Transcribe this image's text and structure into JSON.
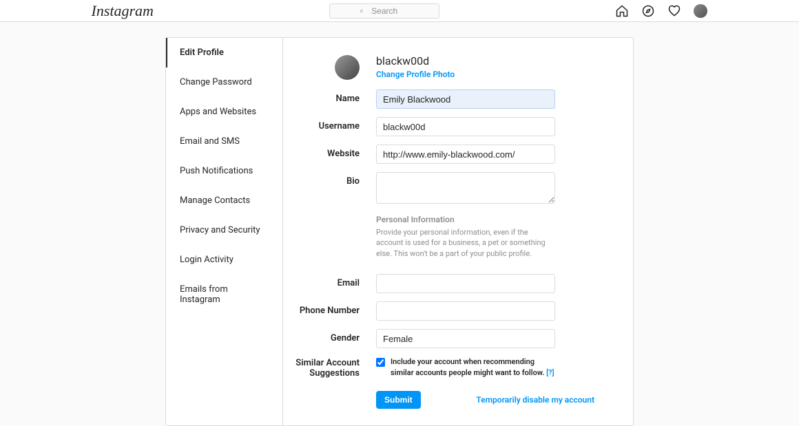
{
  "brand": "Instagram",
  "search": {
    "placeholder": "Search"
  },
  "sidebar": {
    "items": [
      {
        "label": "Edit Profile",
        "active": true
      },
      {
        "label": "Change Password",
        "active": false
      },
      {
        "label": "Apps and Websites",
        "active": false
      },
      {
        "label": "Email and SMS",
        "active": false
      },
      {
        "label": "Push Notifications",
        "active": false
      },
      {
        "label": "Manage Contacts",
        "active": false
      },
      {
        "label": "Privacy and Security",
        "active": false
      },
      {
        "label": "Login Activity",
        "active": false
      },
      {
        "label": "Emails from Instagram",
        "active": false
      }
    ]
  },
  "profile": {
    "username": "blackw00d",
    "change_photo_label": "Change Profile Photo"
  },
  "labels": {
    "name": "Name",
    "username": "Username",
    "website": "Website",
    "bio": "Bio",
    "email": "Email",
    "phone": "Phone Number",
    "gender": "Gender",
    "similar": "Similar Account Suggestions"
  },
  "values": {
    "name": "Emily Blackwood",
    "username": "blackw00d",
    "website": "http://www.emily-blackwood.com/",
    "bio": "",
    "email": "",
    "phone": "",
    "gender": "Female"
  },
  "personal_info": {
    "heading": "Personal Information",
    "description": "Provide your personal information, even if the account is used for a business, a pet or something else. This won't be a part of your public profile."
  },
  "similar": {
    "checkbox_label": "Include your account when recommending similar accounts people might want to follow.",
    "help": "[?]",
    "checked": true
  },
  "actions": {
    "submit": "Submit",
    "disable": "Temporarily disable my account"
  }
}
